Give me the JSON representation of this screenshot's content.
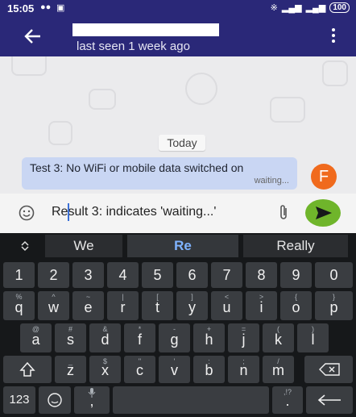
{
  "status_bar": {
    "time": "15:05",
    "battery": "100"
  },
  "header": {
    "last_seen": "last seen 1 week ago"
  },
  "chat": {
    "day_label": "Today",
    "message": {
      "text": "Test 3: No WiFi or mobile data switched on",
      "status": "waiting..."
    },
    "avatar_letter": "F"
  },
  "composer": {
    "draft_text": "Result 3:  indicates 'waiting...'"
  },
  "keyboard": {
    "suggestions": [
      "We",
      "Re",
      "Really"
    ],
    "rows": [
      [
        "1",
        "2",
        "3",
        "4",
        "5",
        "6",
        "7",
        "8",
        "9",
        "0"
      ],
      [
        {
          "main": "q",
          "sub": "%"
        },
        {
          "main": "w",
          "sub": "^"
        },
        {
          "main": "e",
          "sub": "~"
        },
        {
          "main": "r",
          "sub": "|"
        },
        {
          "main": "t",
          "sub": "["
        },
        {
          "main": "y",
          "sub": "]"
        },
        {
          "main": "u",
          "sub": "<"
        },
        {
          "main": "i",
          "sub": ">"
        },
        {
          "main": "o",
          "sub": "{"
        },
        {
          "main": "p",
          "sub": "}"
        }
      ],
      [
        {
          "main": "a",
          "sub": "@"
        },
        {
          "main": "s",
          "sub": "#"
        },
        {
          "main": "d",
          "sub": "&"
        },
        {
          "main": "f",
          "sub": "*"
        },
        {
          "main": "g",
          "sub": "-"
        },
        {
          "main": "h",
          "sub": "+"
        },
        {
          "main": "j",
          "sub": "="
        },
        {
          "main": "k",
          "sub": "("
        },
        {
          "main": "l",
          "sub": ")"
        }
      ],
      [
        {
          "main": "z",
          "sub": "_"
        },
        {
          "main": "x",
          "sub": "$"
        },
        {
          "main": "c",
          "sub": "\""
        },
        {
          "main": "v",
          "sub": "'"
        },
        {
          "main": "b",
          "sub": ":"
        },
        {
          "main": "n",
          "sub": ";"
        },
        {
          "main": "m",
          "sub": "/"
        }
      ]
    ],
    "mode_key": "123",
    "comma": ",",
    "period": ".",
    "period_sub": ",!?"
  },
  "icons": [
    "back-arrow-icon",
    "kebab-menu-icon",
    "emoji-icon",
    "paperclip-icon",
    "send-icon",
    "shift-icon",
    "backspace-icon",
    "enter-icon",
    "microphone-icon",
    "suggestion-toggle-icon"
  ]
}
